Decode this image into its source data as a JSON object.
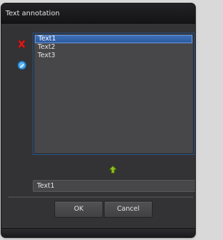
{
  "dialog": {
    "title": "Text annotation"
  },
  "list": {
    "items": [
      "Text1",
      "Text2",
      "Text3"
    ],
    "selected_index": 0
  },
  "text_field": {
    "value": "Text1"
  },
  "buttons": {
    "ok": "OK",
    "cancel": "Cancel"
  },
  "icons": {
    "delete": "delete-x-icon",
    "edit": "edit-pencil-icon",
    "move_up": "arrow-up-icon"
  },
  "colors": {
    "selection": "#3d6fb8",
    "delete_icon": "#d42020",
    "edit_icon": "#3aa0e0",
    "move_up_icon": "#8ec21a"
  }
}
